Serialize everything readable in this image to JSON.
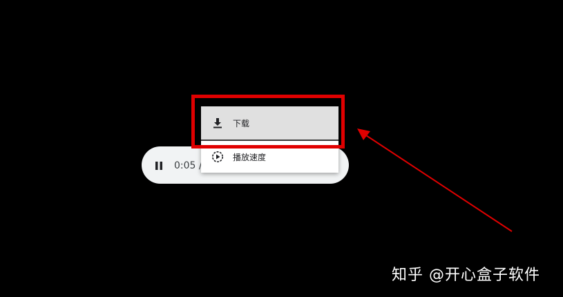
{
  "player": {
    "time_display": "0:05 /",
    "pause_icon": "pause-icon",
    "background": "#f1f3f4"
  },
  "menu": {
    "items": [
      {
        "label": "下载",
        "icon": "download-icon",
        "highlighted": true
      },
      {
        "label": "播放速度",
        "icon": "playback-speed-icon",
        "highlighted": false
      }
    ]
  },
  "annotation": {
    "highlight_color": "#e00000",
    "arrow_color": "#e00000"
  },
  "watermark": {
    "text": "知乎 @开心盒子软件"
  }
}
